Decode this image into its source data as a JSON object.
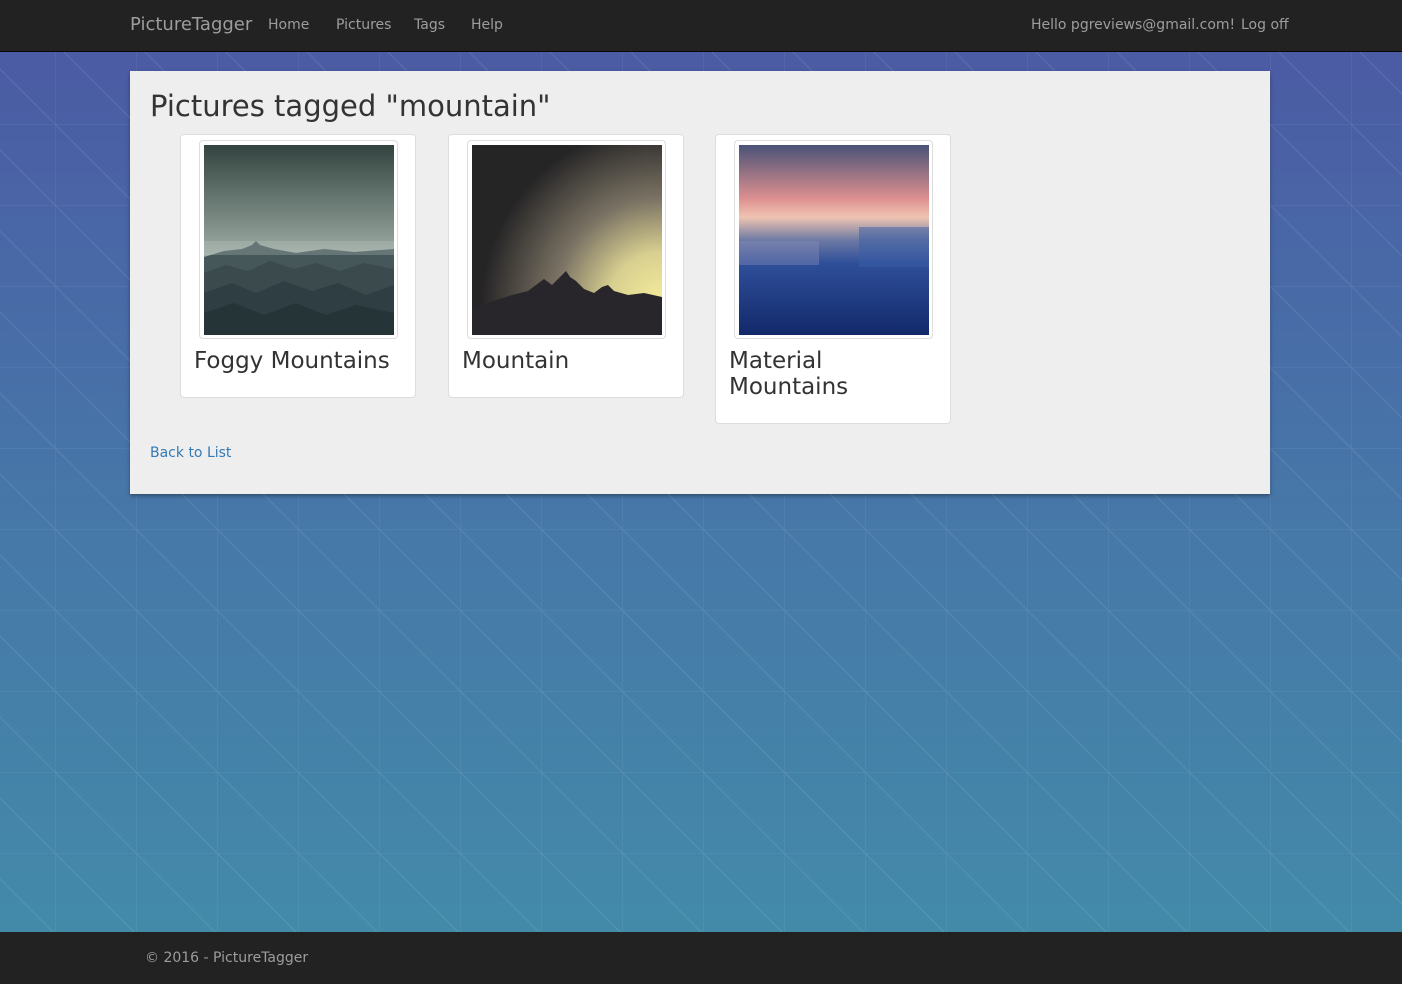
{
  "navbar": {
    "brand": "PictureTagger",
    "links": [
      "Home",
      "Pictures",
      "Tags",
      "Help"
    ],
    "greeting": "Hello pgreviews@gmail.com!",
    "logoff": "Log off"
  },
  "page": {
    "title": "Pictures tagged \"mountain\"",
    "back_link": "Back to List"
  },
  "pictures": [
    {
      "title": "Foggy Mountains"
    },
    {
      "title": "Mountain"
    },
    {
      "title": "Material Mountains"
    }
  ],
  "footer": {
    "copyright": "© 2016 - PictureTagger"
  }
}
